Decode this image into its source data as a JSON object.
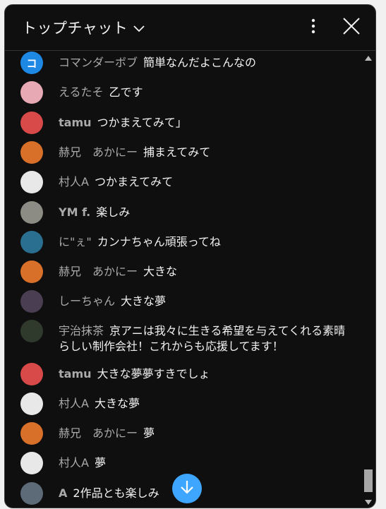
{
  "header": {
    "title": "トップチャット",
    "dropdown_icon": "chevron-down-icon",
    "menu_icon": "more-vert-icon",
    "close_icon": "close-icon"
  },
  "messages": [
    {
      "author": "コマンダーボブ",
      "text": "簡単なんだよこんなの",
      "avatar_text": "コ",
      "avatar_color": "#1e88e5",
      "bold": false
    },
    {
      "author": "えるたそ",
      "text": "乙です",
      "avatar_text": "",
      "avatar_color": "#e7a9b4",
      "bold": false
    },
    {
      "author": "tamu",
      "text": "つかまえてみて」",
      "avatar_text": "",
      "avatar_color": "#d84a4a",
      "bold": true
    },
    {
      "author": "赫兄　あかにー",
      "text": "捕まえてみて",
      "avatar_text": "",
      "avatar_color": "#d9702a",
      "bold": false
    },
    {
      "author": "村人A",
      "text": "つかまえてみて",
      "avatar_text": "",
      "avatar_color": "#e8e8e8",
      "bold": false
    },
    {
      "author": "YM f.",
      "text": "楽しみ",
      "avatar_text": "",
      "avatar_color": "#8c8c84",
      "bold": true
    },
    {
      "author": "に\"ぇ\"",
      "text": "カンナちゃん頑張ってね",
      "avatar_text": "",
      "avatar_color": "#2a6f8f",
      "bold": false
    },
    {
      "author": "赫兄　あかにー",
      "text": "大きな",
      "avatar_text": "",
      "avatar_color": "#d9702a",
      "bold": false
    },
    {
      "author": "しーちゃん",
      "text": "大きな夢",
      "avatar_text": "",
      "avatar_color": "#4a3f52",
      "bold": false
    },
    {
      "author": "宇治抹茶",
      "text": "京アニは我々に生きる希望を与えてくれる素晴らしい制作会社！これからも応援してます！",
      "avatar_text": "",
      "avatar_color": "#2f3a2c",
      "bold": false
    },
    {
      "author": "tamu",
      "text": "大きな夢夢すきでしょ",
      "avatar_text": "",
      "avatar_color": "#d84a4a",
      "bold": true
    },
    {
      "author": "村人A",
      "text": "大きな夢",
      "avatar_text": "",
      "avatar_color": "#e8e8e8",
      "bold": false
    },
    {
      "author": "赫兄　あかにー",
      "text": "夢",
      "avatar_text": "",
      "avatar_color": "#d9702a",
      "bold": false
    },
    {
      "author": "村人A",
      "text": "夢",
      "avatar_text": "",
      "avatar_color": "#e8e8e8",
      "bold": false
    },
    {
      "author": "A",
      "text": "2作品とも楽しみ",
      "avatar_text": "",
      "avatar_color": "#5d6b78",
      "bold": true
    }
  ],
  "scroll_button_icon": "arrow-down-icon",
  "accent": "#3ea6ff"
}
